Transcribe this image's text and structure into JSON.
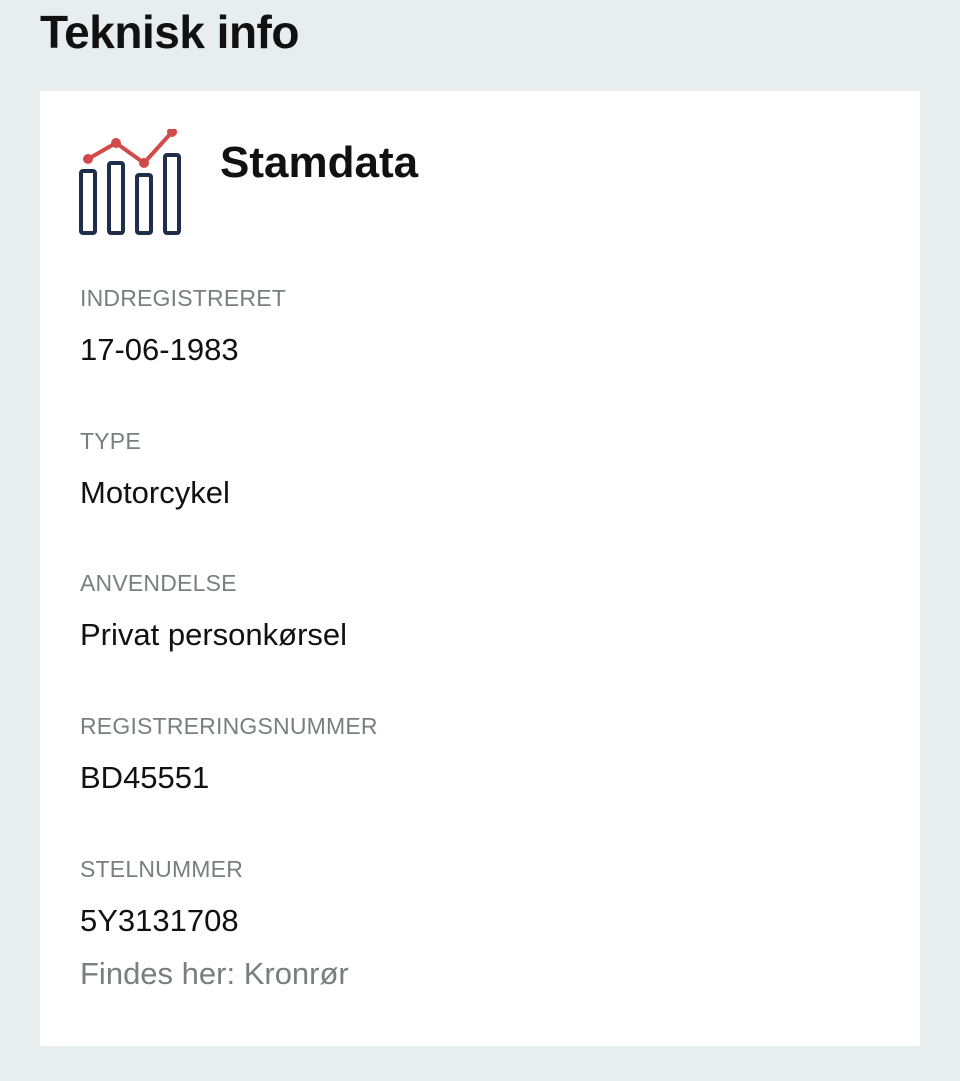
{
  "header": {
    "title": "Teknisk info"
  },
  "card": {
    "icon": "bar-chart-trend-icon",
    "title": "Stamdata",
    "fields": [
      {
        "label": "INDREGISTRERET",
        "value": "17-06-1983"
      },
      {
        "label": "TYPE",
        "value": "Motorcykel"
      },
      {
        "label": "ANVENDELSE",
        "value": "Privat personkørsel"
      },
      {
        "label": "REGISTRERINGSNUMMER",
        "value": "BD45551"
      },
      {
        "label": "STELNUMMER",
        "value": "5Y3131708",
        "hint": "Findes her: Kronrør"
      }
    ]
  },
  "colors": {
    "background": "#e8eded",
    "card": "#ffffff",
    "icon_bars": "#1f2f4a",
    "icon_trend": "#d24b4b",
    "label": "#7b7e80",
    "text": "#111111"
  }
}
